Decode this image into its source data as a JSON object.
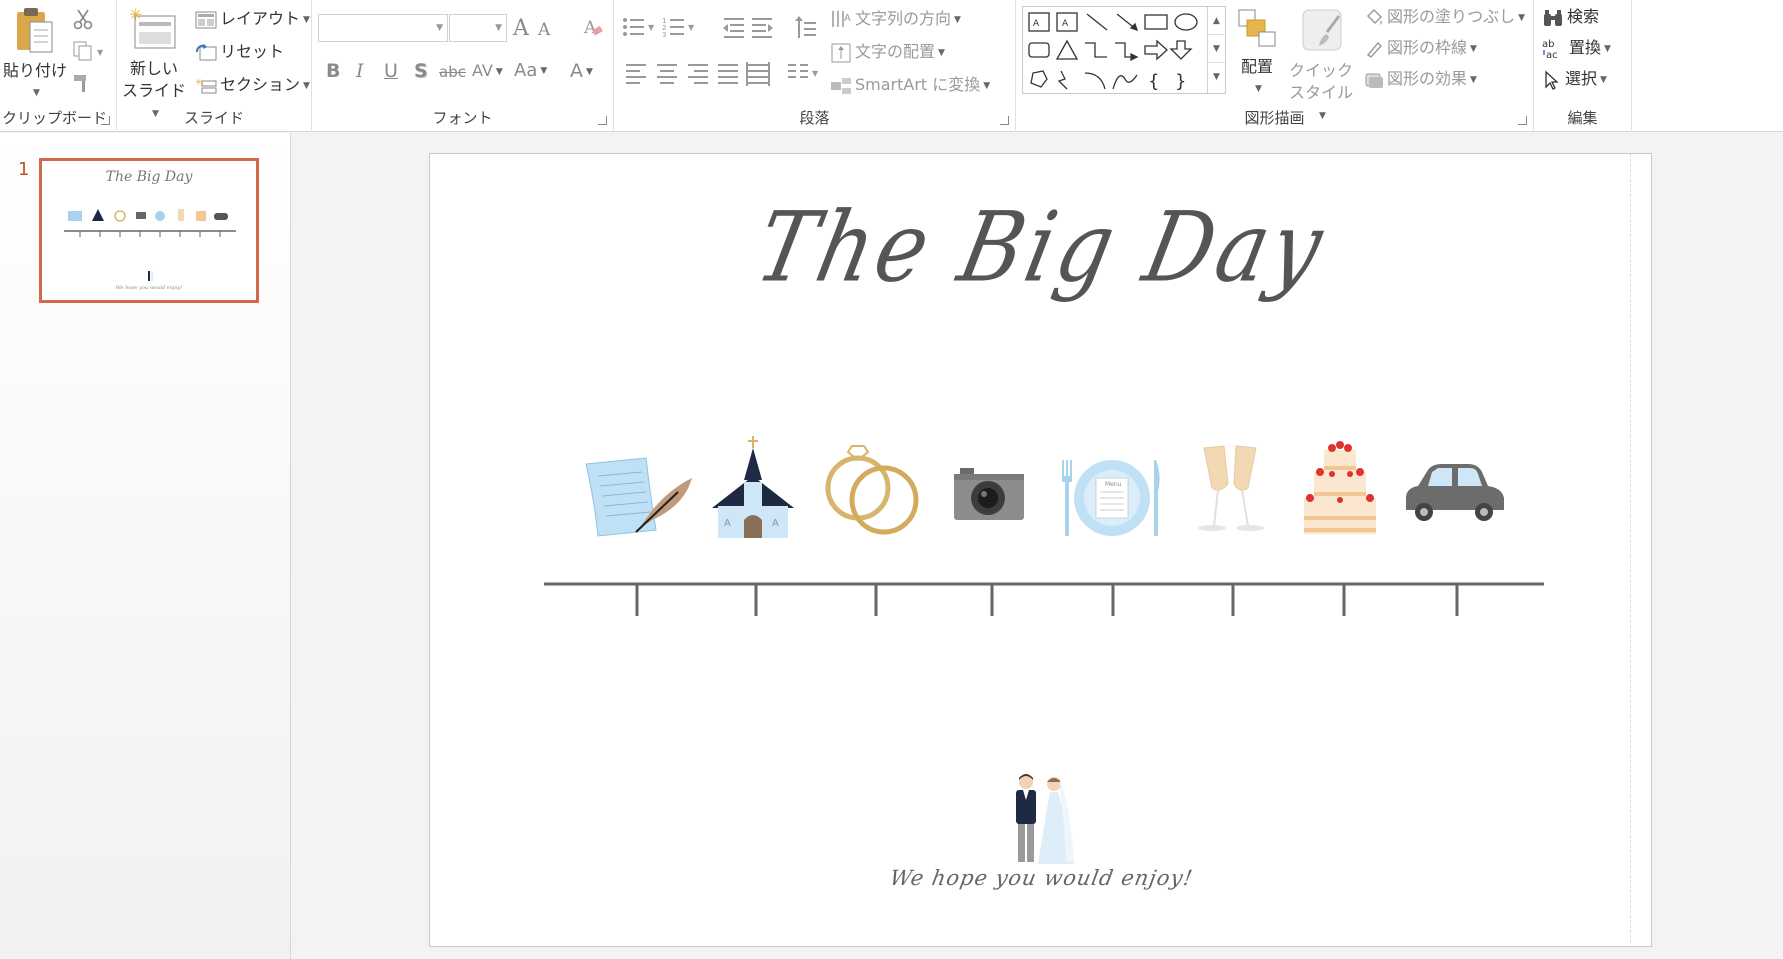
{
  "ribbon": {
    "clipboard": {
      "paste_label": "貼り付け",
      "group_label": "クリップボード"
    },
    "slides": {
      "new_slide_label_1": "新しい",
      "new_slide_label_2": "スライド",
      "layout_label": "レイアウト",
      "reset_label": "リセット",
      "section_label": "セクション",
      "group_label": "スライド"
    },
    "font": {
      "group_label": "フォント",
      "bold": "B",
      "italic": "I",
      "underline": "U",
      "shadow": "S",
      "strike": "abc",
      "spacing": "AV",
      "case": "Aa",
      "color": "A",
      "grow": "A",
      "shrink": "A"
    },
    "paragraph": {
      "group_label": "段落",
      "text_direction_label": "文字列の方向",
      "align_text_label": "文字の配置",
      "smartart_label": "SmartArt に変換"
    },
    "drawing": {
      "group_label": "図形描画",
      "arrange_label": "配置",
      "quick_styles_label_1": "クイック",
      "quick_styles_label_2": "スタイル",
      "fill_label": "図形の塗りつぶし",
      "outline_label": "図形の枠線",
      "effects_label": "図形の効果"
    },
    "editing": {
      "group_label": "編集",
      "find_label": "検索",
      "replace_label": "置換",
      "select_label": "選択"
    }
  },
  "thumbnails": {
    "slide_number": "1",
    "title": "The Big Day",
    "subtitle": "We hope you would enjoy!"
  },
  "slide": {
    "title": "The Big Day",
    "subtitle": "We hope you would enjoy!",
    "timeline_icons": [
      "letter-quill-icon",
      "chapel-icon",
      "rings-icon",
      "camera-icon",
      "dinner-plate-icon",
      "champagne-icon",
      "wedding-cake-icon",
      "car-icon"
    ],
    "couple_icon": "bride-groom-icon",
    "menu_text": "Menu"
  },
  "colors": {
    "accent": "#d2694b",
    "title_gray": "#555555",
    "timeline": "#666666",
    "light_blue": "#a9d2ee",
    "gold": "#d7b56d"
  }
}
